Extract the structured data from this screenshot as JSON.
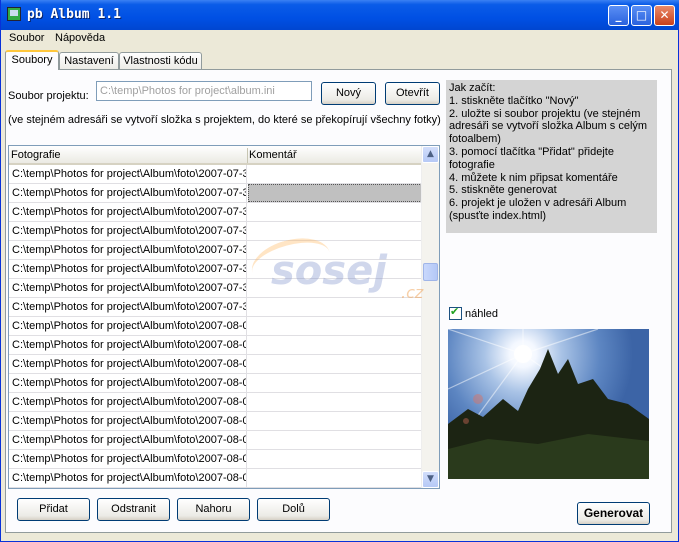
{
  "window": {
    "title": "pb Album 1.1"
  },
  "menu": {
    "items": [
      "Soubor",
      "Nápověda"
    ]
  },
  "tabs": [
    "Soubory",
    "Nastavení",
    "Vlastnosti kódu"
  ],
  "project": {
    "label": "Soubor projektu:",
    "path": "C:\\temp\\Photos for project\\album.ini",
    "new_label": "Nový",
    "open_label": "Otevřít",
    "note": "(ve stejném adresáři se vytvoří složka s projektem, do které se překopírují všechny fotky)"
  },
  "help": {
    "lines": [
      "Jak začít:",
      "1. stiskněte tlačítko \"Nový\"",
      "2. uložte si soubor projektu (ve stejném adresáři se vytvoří složka Album s celým fotoalbem)",
      "3. pomocí tlačítka \"Přidat\" přidejte fotografie",
      "4. můžete k nim připsat komentáře",
      "5. stiskněte generovat",
      "6. projekt je uložen v adresáři Album (spusťte index.html)"
    ]
  },
  "grid": {
    "columns": [
      "Fotografie",
      "Komentář"
    ],
    "rows": [
      "C:\\temp\\Photos for project\\Album\\foto\\2007-07-3",
      "C:\\temp\\Photos for project\\Album\\foto\\2007-07-3",
      "C:\\temp\\Photos for project\\Album\\foto\\2007-07-3",
      "C:\\temp\\Photos for project\\Album\\foto\\2007-07-3",
      "C:\\temp\\Photos for project\\Album\\foto\\2007-07-3",
      "C:\\temp\\Photos for project\\Album\\foto\\2007-07-3",
      "C:\\temp\\Photos for project\\Album\\foto\\2007-07-3",
      "C:\\temp\\Photos for project\\Album\\foto\\2007-07-3",
      "C:\\temp\\Photos for project\\Album\\foto\\2007-08-0",
      "C:\\temp\\Photos for project\\Album\\foto\\2007-08-0",
      "C:\\temp\\Photos for project\\Album\\foto\\2007-08-0",
      "C:\\temp\\Photos for project\\Album\\foto\\2007-08-0",
      "C:\\temp\\Photos for project\\Album\\foto\\2007-08-0",
      "C:\\temp\\Photos for project\\Album\\foto\\2007-08-0",
      "C:\\temp\\Photos for project\\Album\\foto\\2007-08-0",
      "C:\\temp\\Photos for project\\Album\\foto\\2007-08-0",
      "C:\\temp\\Photos for project\\Album\\foto\\2007-08-0"
    ],
    "selected_comment_row": 1
  },
  "actions": {
    "add": "Přidat",
    "remove": "Odstranit",
    "up": "Nahoru",
    "down": "Dolů",
    "generate": "Generovat"
  },
  "preview": {
    "checkbox_label": "náhled",
    "checked": true
  },
  "watermark": {
    "main": "sosej",
    "suffix": ".cz"
  }
}
